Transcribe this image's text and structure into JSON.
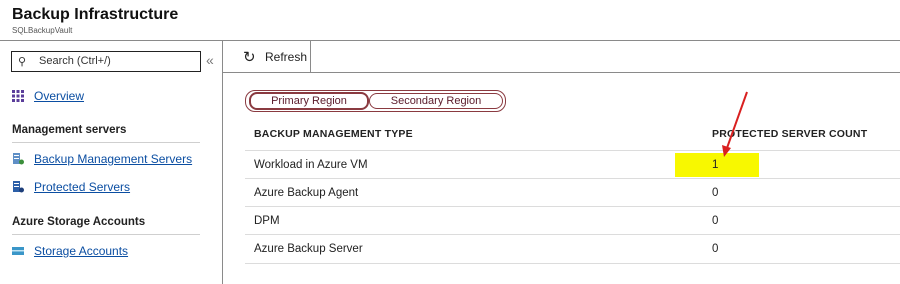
{
  "header": {
    "title": "Backup Infrastructure",
    "subtitle": "SQLBackupVault"
  },
  "sidebar": {
    "search_placeholder": "Search (Ctrl+/)",
    "collapse_glyph": "«",
    "overview_label": "Overview",
    "sections": [
      {
        "title": "Management servers",
        "items": [
          {
            "label": "Backup Management Servers",
            "icon": "server-icon"
          },
          {
            "label": "Protected Servers",
            "icon": "protected-server-icon"
          }
        ]
      },
      {
        "title": "Azure Storage Accounts",
        "items": [
          {
            "label": "Storage Accounts",
            "icon": "storage-icon"
          }
        ]
      }
    ]
  },
  "toolbar": {
    "refresh_label": "Refresh"
  },
  "region_tabs": {
    "primary": "Primary Region",
    "secondary": "Secondary Region",
    "selected": "Primary Region"
  },
  "table": {
    "headers": [
      "BACKUP MANAGEMENT TYPE",
      "PROTECTED SERVER COUNT"
    ],
    "rows": [
      {
        "type": "Workload in Azure VM",
        "count": "1"
      },
      {
        "type": "Azure Backup Agent",
        "count": "0"
      },
      {
        "type": "DPM",
        "count": "0"
      },
      {
        "type": "Azure Backup Server",
        "count": "0"
      }
    ]
  },
  "colors": {
    "link": "#0b4ea2",
    "highlight": "#f8f800",
    "tab_border": "#8a3a40",
    "annotation_arrow": "#d92020"
  }
}
